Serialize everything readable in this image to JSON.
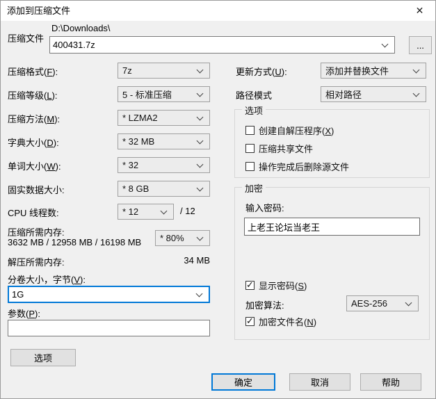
{
  "window": {
    "title": "添加到压缩文件",
    "close_glyph": "✕"
  },
  "colors": {
    "accent": "#0078d7",
    "dialog_bg": "#f0f0f0",
    "titlebar_bg": "#ffffff"
  },
  "archive": {
    "label": "压缩文件",
    "dir": "D:\\Downloads\\",
    "name": "400431.7z",
    "browse_label": "..."
  },
  "left": {
    "rows": [
      {
        "label": "压缩格式(F):",
        "value": "7z"
      },
      {
        "label": "压缩等级(L):",
        "value": "5 - 标准压缩"
      },
      {
        "label": "压缩方法(M):",
        "value": "* LZMA2"
      },
      {
        "label": "字典大小(D):",
        "value": "* 32 MB"
      },
      {
        "label": "单词大小(W):",
        "value": "* 32"
      },
      {
        "label": "固实数据大小:",
        "value": "* 8 GB"
      },
      {
        "label": "CPU 线程数:",
        "value": "* 12"
      }
    ],
    "threads_total": "/ 12",
    "memory": {
      "compress_label": "压缩所需内存:",
      "compress_values": "3632 MB / 12958 MB / 16198 MB",
      "percent_value": "* 80%",
      "decompress_label": "解压所需内存:",
      "decompress_value": "34 MB"
    },
    "volume": {
      "label": "分卷大小，字节(V):",
      "value": "1G"
    },
    "params": {
      "label": "参数(P):",
      "value": ""
    },
    "options_button": "选项"
  },
  "right": {
    "update_label": "更新方式(U):",
    "update_value": "添加并替换文件",
    "path_label": "路径模式",
    "path_value": "相对路径",
    "options_group": {
      "title": "选项",
      "checkboxes": [
        {
          "label": "创建自解压程序(X)",
          "checked": false
        },
        {
          "label": "压缩共享文件",
          "checked": false
        },
        {
          "label": "操作完成后删除源文件",
          "checked": false
        }
      ]
    },
    "encrypt_group": {
      "title": "加密",
      "password_label": "输入密码:",
      "password_value": "上老王论坛当老王",
      "show_password": {
        "label": "显示密码(S)",
        "checked": true
      },
      "method_label": "加密算法:",
      "method_value": "AES-256",
      "encrypt_names": {
        "label": "加密文件名(N)",
        "checked": true
      }
    }
  },
  "footer": {
    "ok": "确定",
    "cancel": "取消",
    "help": "帮助"
  }
}
